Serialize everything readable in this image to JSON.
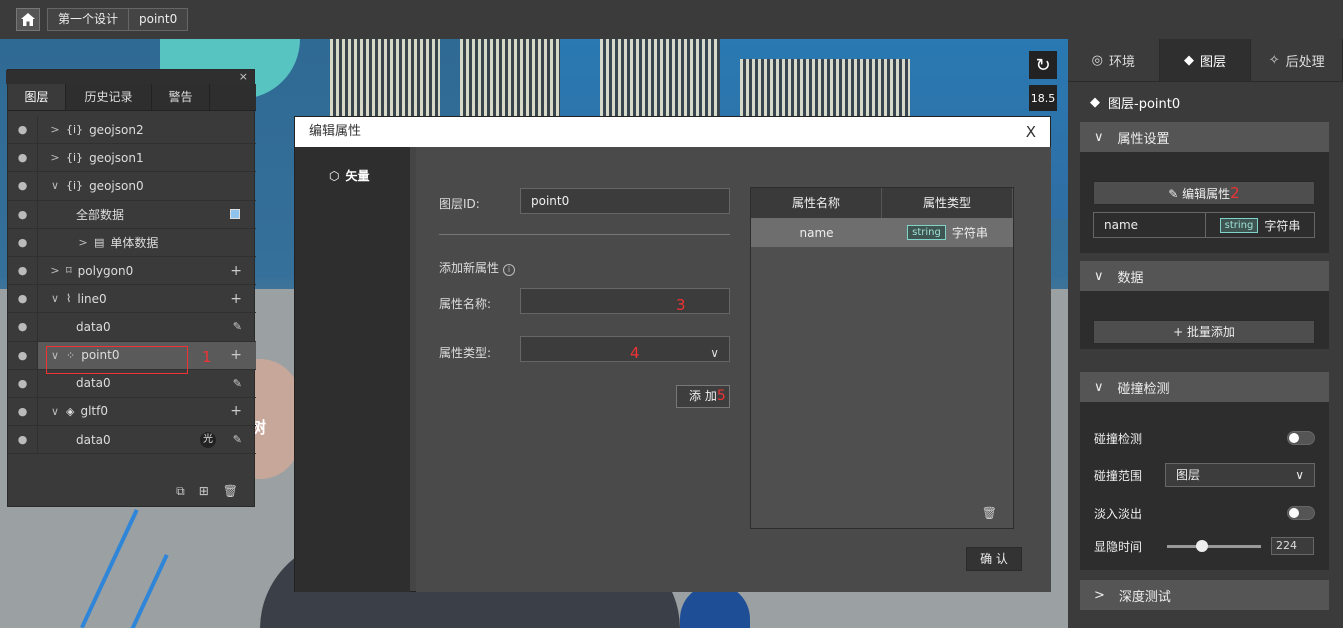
{
  "topbar": {
    "breadcrumbs": [
      "第一个设计",
      "point0"
    ]
  },
  "scene": {
    "zoom": "18.5",
    "overlay_text": "树"
  },
  "layer_panel": {
    "close": "×",
    "tabs": [
      "图层",
      "历史记录",
      "警告"
    ],
    "items": [
      {
        "label": "geojson2",
        "icon": "{i}"
      },
      {
        "label": "geojson1",
        "icon": "{i}"
      },
      {
        "label": "geojson0",
        "icon": "{i}"
      },
      {
        "label": "全部数据"
      },
      {
        "label": "单体数据"
      },
      {
        "label": "polygon0"
      },
      {
        "label": "line0"
      },
      {
        "label": "data0"
      },
      {
        "label": "point0"
      },
      {
        "label": "data0"
      },
      {
        "label": "gltf0"
      },
      {
        "label": "data0",
        "badge": "光"
      }
    ],
    "annotation_1": "1"
  },
  "modal": {
    "title": "编辑属性",
    "close": "X",
    "side_item": "矢量",
    "layer_id_label": "图层ID:",
    "layer_id_value": "point0",
    "add_new_label": "添加新属性",
    "attr_name_label": "属性名称:",
    "attr_type_label": "属性类型:",
    "add_button": "添 加",
    "annotation_3": "3",
    "annotation_4": "4",
    "annotation_5": "5",
    "table": {
      "headers": [
        "属性名称",
        "属性类型"
      ],
      "rows": [
        {
          "name": "name",
          "tag": "string",
          "type": "字符串"
        }
      ]
    },
    "ok_button": "确 认"
  },
  "right_panel": {
    "tabs": [
      "环境",
      "图层",
      "后处理"
    ],
    "title": "图层-point0",
    "sec_attr": "属性设置",
    "edit_attr_button": "编辑属性",
    "annotation_2": "2",
    "attr_row": {
      "name": "name",
      "tag": "string",
      "type": "字符串"
    },
    "sec_data": "数据",
    "batch_add_button": "+ 批量添加",
    "sec_collision": "碰撞检测",
    "collision_label": "碰撞检测",
    "range_label": "碰撞范围",
    "range_value": "图层",
    "fade_label": "淡入淡出",
    "fade_time_label": "显隐时间",
    "fade_time_value": "224",
    "sec_depth": "深度测试"
  }
}
